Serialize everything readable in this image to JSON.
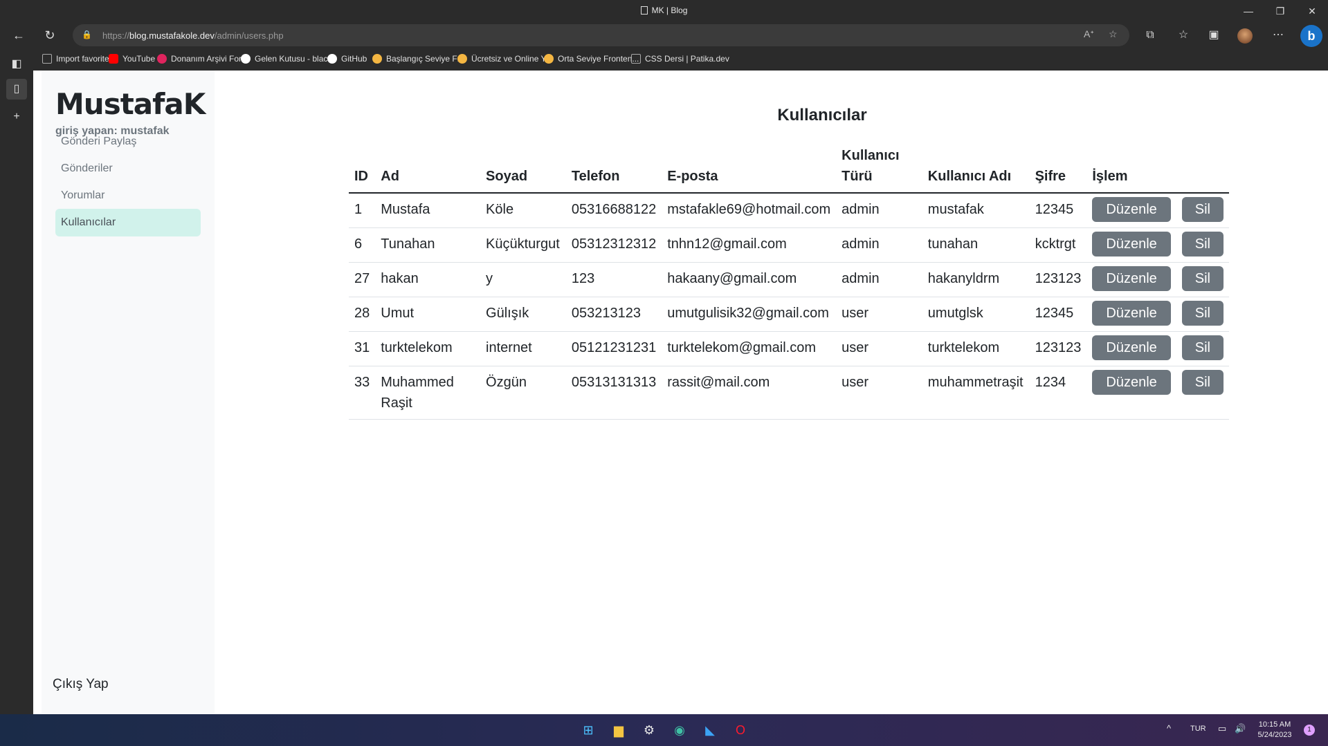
{
  "browser": {
    "tab_title": "MK | Blog",
    "url_prefix": "https://",
    "url_host": "blog.mustafakole.dev",
    "url_path": "/admin/users.php",
    "favorites": [
      {
        "label": "Import favorites",
        "color": "#888888"
      },
      {
        "label": "YouTube",
        "color": "#ff0000"
      },
      {
        "label": "Donanım Arşivi For...",
        "color": "#e0245e"
      },
      {
        "label": "Gelen Kutusu - blac...",
        "color": "#ffffff"
      },
      {
        "label": "GitHub",
        "color": "#ffffff"
      },
      {
        "label": "Başlangıç Seviye Fr...",
        "color": "#f4b642"
      },
      {
        "label": "Ücretsiz ve Online Y...",
        "color": "#f4b642"
      },
      {
        "label": "Orta Seviye Fronten...",
        "color": "#f4b642"
      },
      {
        "label": "CSS Dersi | Patika.dev",
        "color": "#888888"
      }
    ]
  },
  "sidebar": {
    "brand": "MustafaK",
    "logged_in": "giriş yapan: mustafak",
    "items": [
      {
        "label": "Gönderi Paylaş"
      },
      {
        "label": "Gönderiler"
      },
      {
        "label": "Yorumlar"
      },
      {
        "label": "Kullanıcılar"
      }
    ],
    "logout": "Çıkış Yap"
  },
  "main": {
    "heading": "Kullanıcılar",
    "columns": [
      "ID",
      "Ad",
      "Soyad",
      "Telefon",
      "E-posta",
      "Kullanıcı Türü",
      "Kullanıcı Adı",
      "Şifre",
      "İşlem"
    ],
    "edit_label": "Düzenle",
    "delete_label": "Sil",
    "rows": [
      {
        "id": "1",
        "ad": "Mustafa",
        "soyad": "Köle",
        "telefon": "05316688122",
        "eposta": "mstafakle69@hotmail.com",
        "tur": "admin",
        "kadi": "mustafak",
        "sifre": "12345"
      },
      {
        "id": "6",
        "ad": "Tunahan",
        "soyad": "Küçükturgut",
        "telefon": "05312312312",
        "eposta": "tnhn12@gmail.com",
        "tur": "admin",
        "kadi": "tunahan",
        "sifre": "kcktrgt"
      },
      {
        "id": "27",
        "ad": "hakan",
        "soyad": "y",
        "telefon": "123",
        "eposta": "hakaany@gmail.com",
        "tur": "admin",
        "kadi": "hakanyldrm",
        "sifre": "123123"
      },
      {
        "id": "28",
        "ad": "Umut",
        "soyad": "Gülışık",
        "telefon": "053213123",
        "eposta": "umutgulisik32@gmail.com",
        "tur": "user",
        "kadi": "umutglsk",
        "sifre": "12345"
      },
      {
        "id": "31",
        "ad": "turktelekom",
        "soyad": "internet",
        "telefon": "05121231231",
        "eposta": "turktelekom@gmail.com",
        "tur": "user",
        "kadi": "turktelekom",
        "sifre": "123123"
      },
      {
        "id": "33",
        "ad": "Muhammed Raşit",
        "soyad": "Özgün",
        "telefon": "05313131313",
        "eposta": "rassit@mail.com",
        "tur": "user",
        "kadi": "muhammetraşit",
        "sifre": "1234"
      }
    ]
  },
  "taskbar": {
    "language": "TUR",
    "time": "10:15 AM",
    "date": "5/24/2023",
    "notifications": "1"
  }
}
